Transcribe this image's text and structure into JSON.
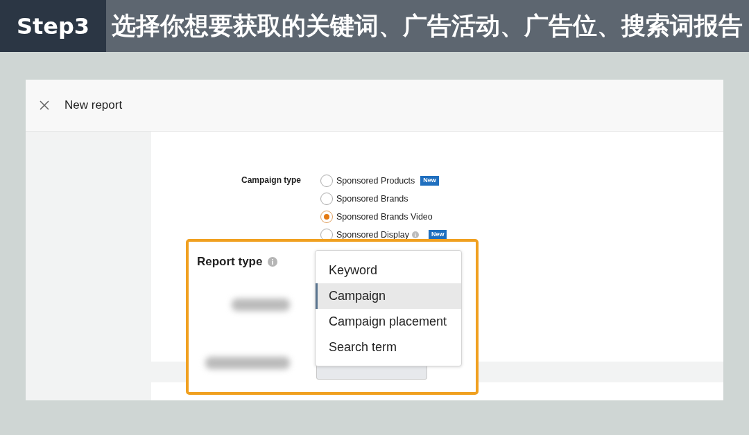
{
  "header": {
    "step": "Step3",
    "title": "选择你想要获取的关键词、广告活动、广告位、搜索词报告"
  },
  "dialog": {
    "title": "New report"
  },
  "campaign_type": {
    "label": "Campaign type",
    "options": [
      {
        "label": "Sponsored Products",
        "selected": false,
        "info": false,
        "badge": "New"
      },
      {
        "label": "Sponsored Brands",
        "selected": false,
        "info": false
      },
      {
        "label": "Sponsored Brands Video",
        "selected": true,
        "info": false
      },
      {
        "label": "Sponsored Display",
        "selected": false,
        "info": true,
        "badge": "New"
      }
    ]
  },
  "report_type": {
    "label": "Report type",
    "options": [
      {
        "label": "Keyword",
        "selected": false
      },
      {
        "label": "Campaign",
        "selected": true
      },
      {
        "label": "Campaign placement",
        "selected": false
      },
      {
        "label": "Search term",
        "selected": false
      }
    ]
  }
}
